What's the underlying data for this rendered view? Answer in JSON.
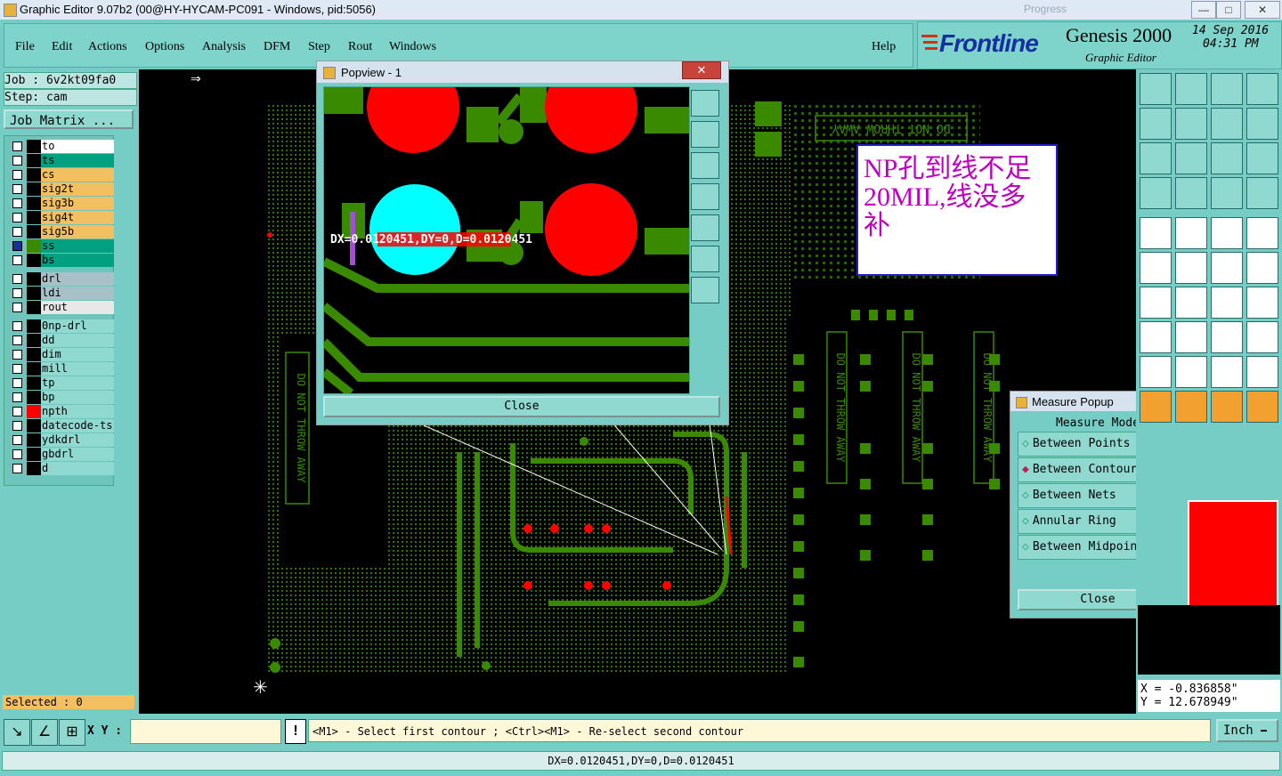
{
  "window": {
    "title": "Graphic Editor 9.07b2 (00@HY-HYCAM-PC091 - Windows, pid:5056)",
    "progress_label": "Progress"
  },
  "menu": [
    "File",
    "Edit",
    "Actions",
    "Options",
    "Analysis",
    "DFM",
    "Step",
    "Rout",
    "Windows"
  ],
  "help_label": "Help",
  "brand": {
    "logo": "Frontline",
    "product": "Genesis 2000",
    "subtitle": "Graphic Editor",
    "date": "14 Sep 2016",
    "time": "04:31 PM"
  },
  "job": {
    "job_label": "Job : 6v2kt09fa0",
    "step_label": "Step: cam",
    "matrix_button": "Job Matrix ..."
  },
  "layers": [
    {
      "name": "to",
      "color": "#ffffff"
    },
    {
      "name": "ts",
      "color": "#00a080"
    },
    {
      "name": "cs",
      "color": "#f2c060"
    },
    {
      "name": "sig2t",
      "color": "#f2c060"
    },
    {
      "name": "sig3b",
      "color": "#f2c060"
    },
    {
      "name": "sig4t",
      "color": "#f2c060"
    },
    {
      "name": "sig5b",
      "color": "#f2c060"
    },
    {
      "name": "ss",
      "color": "#00a080"
    },
    {
      "name": "bs",
      "color": "#00a080"
    },
    {
      "name": "drl",
      "color": "#a8c0c8"
    },
    {
      "name": "ldi",
      "color": "#a8c0c8"
    },
    {
      "name": "rout",
      "color": "#e8e8e8"
    },
    {
      "name": "0np-drl",
      "color": "#8fd9d1"
    },
    {
      "name": "dd",
      "color": "#8fd9d1"
    },
    {
      "name": "dim",
      "color": "#8fd9d1"
    },
    {
      "name": "mill",
      "color": "#8fd9d1"
    },
    {
      "name": "tp",
      "color": "#8fd9d1"
    },
    {
      "name": "bp",
      "color": "#8fd9d1"
    },
    {
      "name": "npth",
      "color": "#8fd9d1"
    },
    {
      "name": "datecode-ts",
      "color": "#8fd9d1"
    },
    {
      "name": "ydkdrl",
      "color": "#8fd9d1"
    },
    {
      "name": "gbdrl",
      "color": "#8fd9d1"
    },
    {
      "name": "d",
      "color": "#8fd9d1"
    }
  ],
  "selected_label": "Selected : 0",
  "popview": {
    "title": "Popview - 1",
    "measure_text": "DX=0.0120451,DY=0,D=0.0120451",
    "close": "Close"
  },
  "note": {
    "text": "NP孔到线不足20MIL,线没多补"
  },
  "silk_text": "DO NOT THROW AWAY",
  "measure_popup": {
    "title": "Measure Popup",
    "mode_label": "Measure Mode",
    "options": [
      "Between Points",
      "Between Contours",
      "Between Nets",
      "Annular Ring",
      "Between Midpoints"
    ],
    "selected": "Between Contours",
    "close": "Close"
  },
  "coords": {
    "x": "X = -0.836858\"",
    "y": "Y = 12.678949\""
  },
  "xy_label": "X Y :",
  "xy_value": "",
  "status_hint": "<M1> - Select first contour ; <Ctrl><M1> - Re-select second contour",
  "units": "Inch",
  "bottom_status": "DX=0.0120451,DY=0,D=0.0120451",
  "colors": {
    "panel": "#76cdc5",
    "trace": "#3a8a00",
    "pad_red": "#ff0000",
    "highlight": "#00ffff"
  }
}
